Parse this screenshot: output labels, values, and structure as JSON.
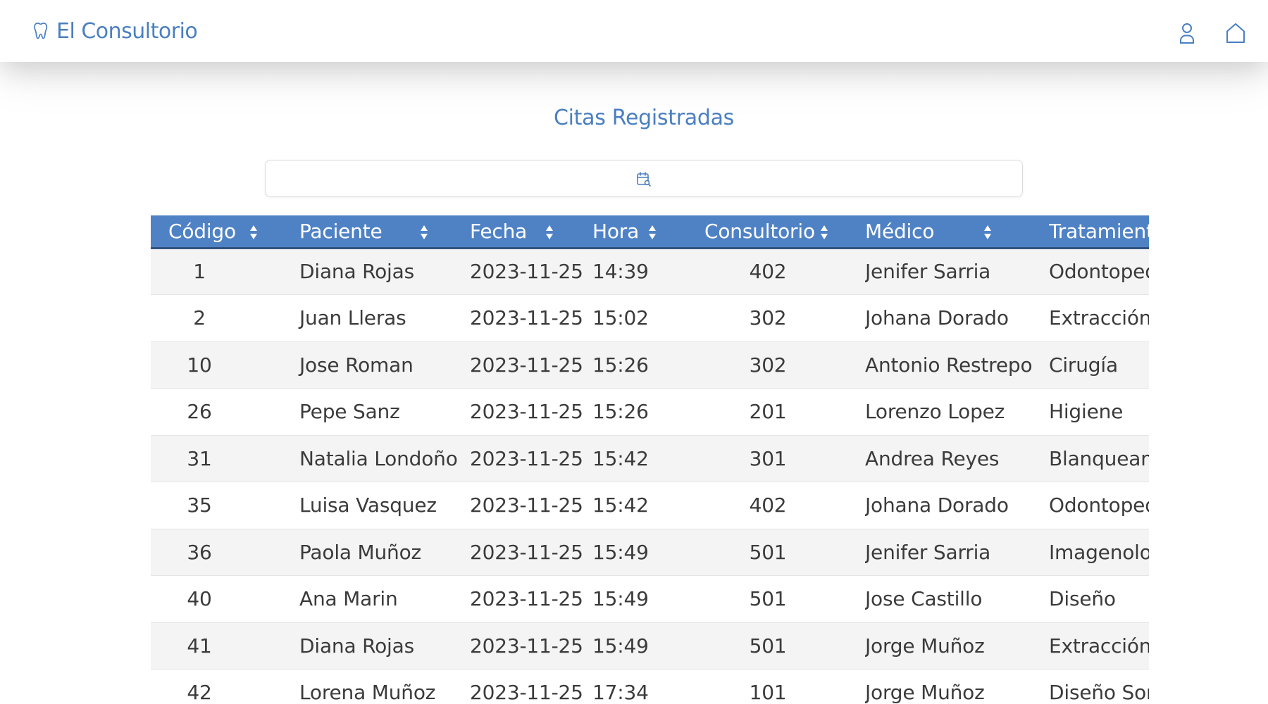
{
  "navbar": {
    "brand": "El Consultorio",
    "brand_icon": "tooth-icon",
    "icons": [
      "user-icon",
      "home-icon"
    ]
  },
  "page": {
    "title": "Citas Registradas"
  },
  "filter": {
    "icon": "calendar-search-icon"
  },
  "table": {
    "headers": [
      "Código",
      "Paciente",
      "Fecha",
      "Hora",
      "Consultorio",
      "Médico",
      "Tratamiento"
    ],
    "rows": [
      [
        "1",
        "Diana Rojas",
        "2023-11-25",
        "14:39",
        "402",
        "Jenifer Sarria",
        "Odontopediatría"
      ],
      [
        "2",
        "Juan Lleras",
        "2023-11-25",
        "15:02",
        "302",
        "Johana Dorado",
        "Extracción"
      ],
      [
        "10",
        "Jose Roman",
        "2023-11-25",
        "15:26",
        "302",
        "Antonio Restrepo",
        "Cirugía"
      ],
      [
        "26",
        "Pepe Sanz",
        "2023-11-25",
        "15:26",
        "201",
        "Lorenzo Lopez",
        "Higiene"
      ],
      [
        "31",
        "Natalia Londoño",
        "2023-11-25",
        "15:42",
        "301",
        "Andrea Reyes",
        "Blanqueamiento"
      ],
      [
        "35",
        "Luisa Vasquez",
        "2023-11-25",
        "15:42",
        "402",
        "Johana Dorado",
        "Odontopediatría"
      ],
      [
        "36",
        "Paola Muñoz",
        "2023-11-25",
        "15:49",
        "501",
        "Jenifer Sarria",
        "Imagenología"
      ],
      [
        "40",
        "Ana Marin",
        "2023-11-25",
        "15:49",
        "501",
        "Jose Castillo",
        "Diseño"
      ],
      [
        "41",
        "Diana Rojas",
        "2023-11-25",
        "15:49",
        "501",
        "Jorge Muñoz",
        "Extracción"
      ],
      [
        "42",
        "Lorena Muñoz",
        "2023-11-25",
        "17:34",
        "101",
        "Jorge Muñoz",
        "Diseño Sonrisa"
      ]
    ]
  },
  "colors": {
    "accent": "#4a7fc1",
    "header_bg": "#4f82c5",
    "header_border": "#31527f",
    "row_alt": "#f4f4f4"
  }
}
